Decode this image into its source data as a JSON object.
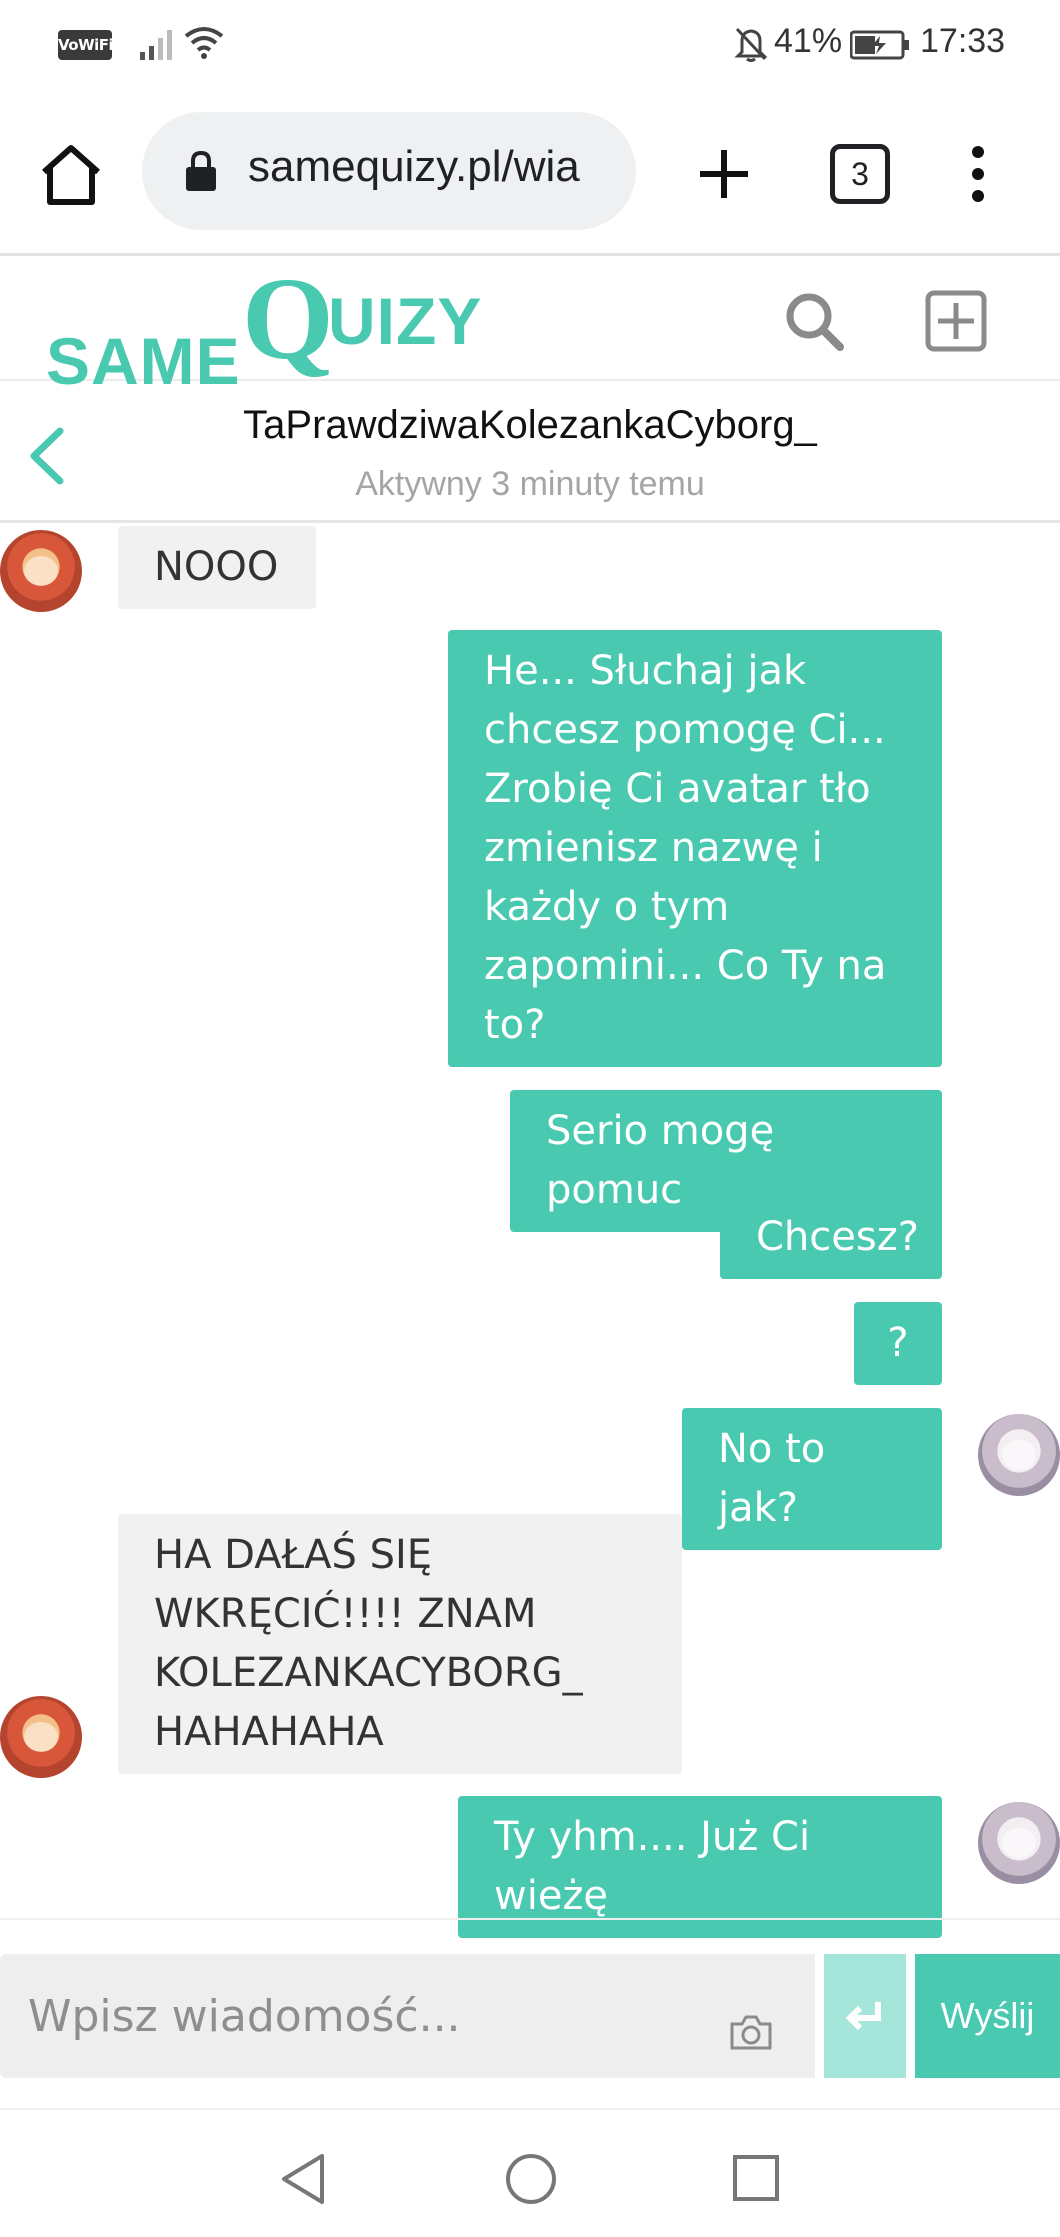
{
  "status_bar": {
    "vowifi_label": "VoWiFi",
    "battery_percent": "41%",
    "time": "17:33",
    "icons": [
      "signal-icon",
      "wifi-icon",
      "bell-off-icon",
      "battery-charging-icon"
    ]
  },
  "browser": {
    "url": "samequizy.pl/wia",
    "tab_count": "3",
    "icons": [
      "home-icon",
      "lock-icon",
      "plus-icon",
      "more-vert-icon"
    ]
  },
  "site": {
    "logo_part1": "SAME",
    "logo_part2": "Q",
    "logo_part3": "UIZY",
    "accent_color": "#48c9b0",
    "icons": [
      "search-icon",
      "add-box-icon"
    ]
  },
  "chat": {
    "name": "TaPrawdziwaKolezankaCyborg_",
    "status": "Aktywny 3 minuty temu",
    "messages": [
      {
        "from": "other",
        "text": "NOOO"
      },
      {
        "from": "me",
        "text": "He... Słuchaj jak chcesz pomogę Ci... Zrobię Ci avatar tło zmienisz nazwę i każdy o tym zapomini... Co Ty na to?"
      },
      {
        "from": "me",
        "text": "Serio mogę pomuc"
      },
      {
        "from": "me",
        "text": "Chcesz?"
      },
      {
        "from": "me",
        "text": "?"
      },
      {
        "from": "me",
        "text": "No to jak?"
      },
      {
        "from": "other",
        "text": "HA DAŁAŚ SIĘ WKRĘCIĆ!!!! ZNAM KOLEZANKACYBORG_ HAHAHAHA"
      },
      {
        "from": "me",
        "text": "Ty yhm.... Już Ci wieżę"
      }
    ]
  },
  "composer": {
    "placeholder": "Wpisz wiadomość...",
    "enter_symbol": "↵",
    "send_label": "Wyślij"
  },
  "nav_bar": {
    "icons": [
      "nav-back-icon",
      "nav-home-icon",
      "nav-recents-icon"
    ]
  }
}
